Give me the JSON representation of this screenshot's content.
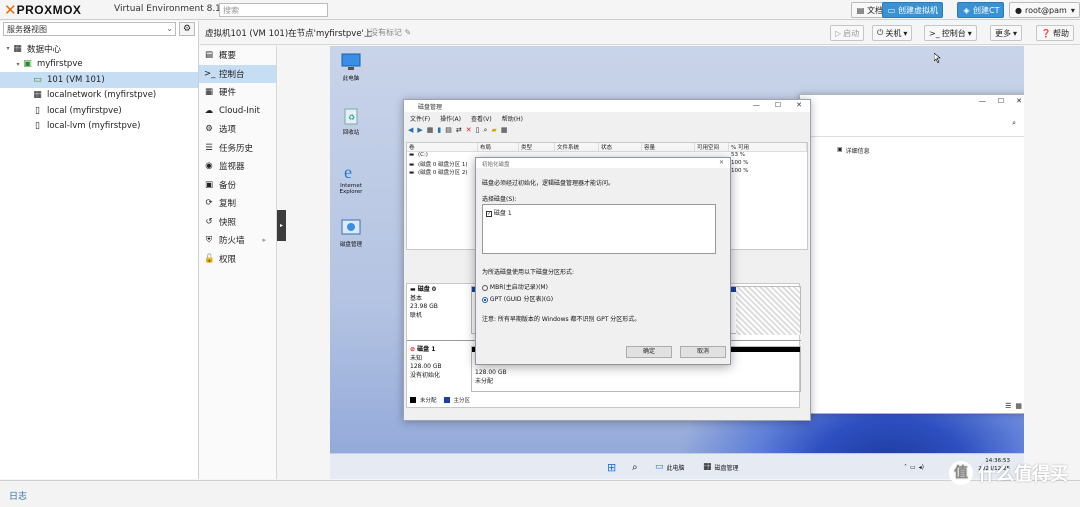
{
  "topbar": {
    "brand": "PROXMOX",
    "product": "Virtual Environment 8.1.3",
    "search_placeholder": "搜索",
    "docs": "文档",
    "create_vm": "创建虚拟机",
    "create_ct": "创建CT",
    "user": "root@pam"
  },
  "left": {
    "view_selector": "服务器视图",
    "tree": [
      {
        "label": "数据中心",
        "icon": "datacenter-icon"
      },
      {
        "label": "myfirstpve",
        "icon": "node-icon"
      },
      {
        "label": "101 (VM 101)",
        "icon": "vm-running-icon"
      },
      {
        "label": "localnetwork (myfirstpve)",
        "icon": "network-icon"
      },
      {
        "label": "local (myfirstpve)",
        "icon": "storage-icon"
      },
      {
        "label": "local-lvm (myfirstpve)",
        "icon": "storage-icon"
      }
    ]
  },
  "vmheader": {
    "title": "虚拟机101 (VM 101)在节点'myfirstpve'上",
    "tags": "没有标记",
    "start": "启动",
    "shutdown": "关机",
    "console": "控制台",
    "more": "更多",
    "help": "帮助"
  },
  "nav": [
    {
      "label": "概要",
      "icon": "summary-icon"
    },
    {
      "label": "控制台",
      "icon": "console-icon"
    },
    {
      "label": "硬件",
      "icon": "hardware-icon"
    },
    {
      "label": "Cloud-Init",
      "icon": "cloud-icon"
    },
    {
      "label": "选项",
      "icon": "options-icon"
    },
    {
      "label": "任务历史",
      "icon": "task-history-icon"
    },
    {
      "label": "监视器",
      "icon": "monitor-icon"
    },
    {
      "label": "备份",
      "icon": "backup-icon"
    },
    {
      "label": "复制",
      "icon": "replication-icon"
    },
    {
      "label": "快照",
      "icon": "snapshot-icon"
    },
    {
      "label": "防火墙",
      "icon": "firewall-icon"
    },
    {
      "label": "权限",
      "icon": "permissions-icon"
    }
  ],
  "desktop": {
    "icons": [
      "此电脑",
      "回收站",
      "Internet Explorer",
      "磁盘管理"
    ],
    "taskbar_this_pc": "此电脑",
    "taskbar_disk_mgmt": "磁盘管理",
    "clock_time": "14:36:53",
    "clock_date": "2023/12/25",
    "explorer_details": "详细信息"
  },
  "diskmgmt": {
    "title": "磁盘管理",
    "menu": [
      "文件(F)",
      "操作(A)",
      "查看(V)",
      "帮助(H)"
    ],
    "columns": [
      "卷",
      "布局",
      "类型",
      "文件系统",
      "状态",
      "容量",
      "可用空间",
      "% 可用"
    ],
    "rows": [
      {
        "vol": "(C:)",
        "pct": "53 %"
      },
      {
        "vol": "(磁盘 0 磁盘分区 1)",
        "pct": "100 %"
      },
      {
        "vol": "(磁盘 0 磁盘分区 2)",
        "pct": "100 %"
      }
    ],
    "disk0": {
      "name": "磁盘 0",
      "type": "基本",
      "size": "23.98 GB",
      "status": "联机"
    },
    "disk1": {
      "name": "磁盘 1",
      "type": "未知",
      "size": "128.00 GB",
      "status": "没有初始化",
      "unalloc_size": "128.00 GB",
      "unalloc_label": "未分配"
    },
    "legend": [
      "未分配",
      "主分区"
    ]
  },
  "dialog": {
    "title": "初始化磁盘",
    "intro": "磁盘必须经过初始化，逻辑磁盘管理器才能访问。",
    "select_label": "选择磁盘(S):",
    "disk_item": "磁盘 1",
    "style_label": "为所选磁盘使用以下磁盘分区形式:",
    "mbr": "MBR(主启动记录)(M)",
    "gpt": "GPT (GUID 分区表)(G)",
    "note": "注意: 所有早期版本的 Windows 都不识别 GPT 分区形式。",
    "ok": "确定",
    "cancel": "取消"
  },
  "logbar": {
    "label": "日志"
  },
  "watermark": {
    "text": "什么值得买"
  }
}
